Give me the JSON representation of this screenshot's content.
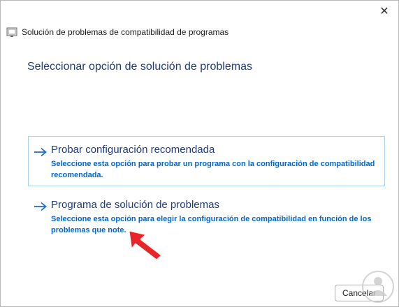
{
  "window": {
    "title": "Solución de problemas de compatibilidad de programas",
    "close_glyph": "✕"
  },
  "page": {
    "heading": "Seleccionar opción de solución de problemas"
  },
  "options": [
    {
      "title": "Probar configuración recomendada",
      "description": "Seleccione esta opción para probar un programa con la configuración de compatibilidad recomendada.",
      "icon": "arrow-right-icon",
      "highlighted": true
    },
    {
      "title": "Programa de solución de problemas",
      "description": "Seleccione esta opción para elegir la configuración de compatibilidad en función de los problemas que note.",
      "icon": "arrow-right-icon",
      "highlighted": false
    }
  ],
  "footer": {
    "cancel_label": "Cancelar"
  },
  "colors": {
    "heading": "#1f3b7a",
    "description": "#0066cc",
    "hover_border": "#a9d3ec",
    "annotation_arrow": "#e8262a"
  }
}
